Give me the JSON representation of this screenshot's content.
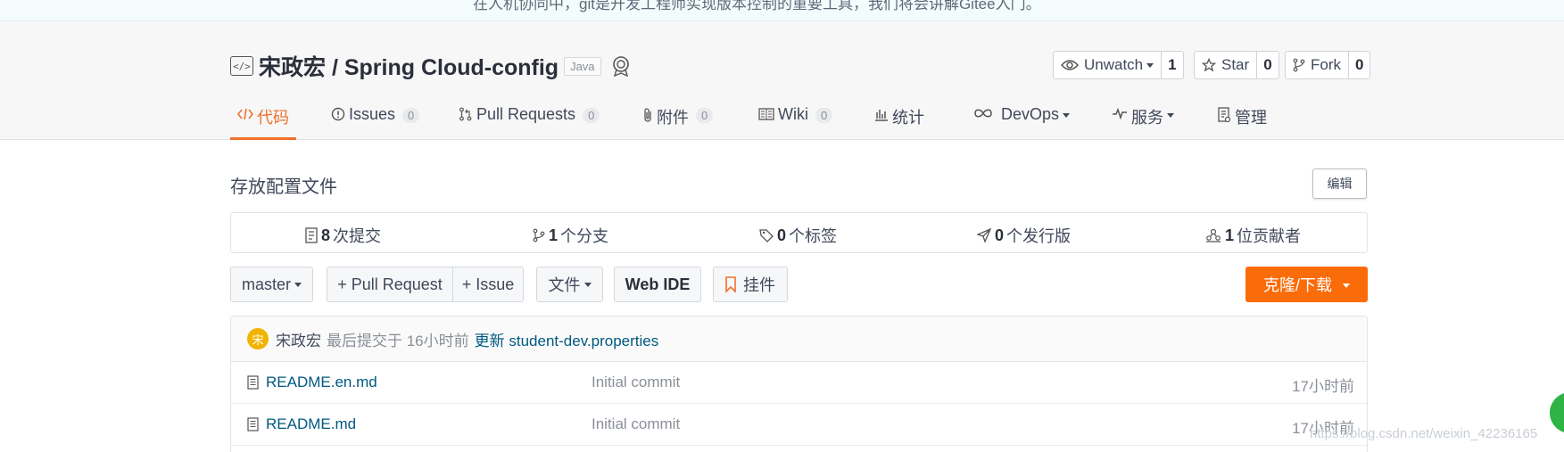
{
  "banner": {
    "text": "在人机协同中，git是开发工程师实现版本控制的重要工具，我们将会讲解Gitee入门。"
  },
  "repo": {
    "owner_and_name": "宋政宏 / Spring Cloud-config",
    "language": "Java",
    "description": "存放配置文件",
    "edit_label": "编辑"
  },
  "actions": {
    "watch_label": "Unwatch",
    "watch_count": "1",
    "star_label": "Star",
    "star_count": "0",
    "fork_label": "Fork",
    "fork_count": "0"
  },
  "tabs": [
    {
      "label": "代码",
      "icon": "code-icon"
    },
    {
      "label": "Issues",
      "count": "0",
      "icon": "issue-icon"
    },
    {
      "label": "Pull Requests",
      "count": "0",
      "icon": "pull-request-icon"
    },
    {
      "label": "附件",
      "count": "0",
      "icon": "paperclip-icon"
    },
    {
      "label": "Wiki",
      "count": "0",
      "icon": "wiki-icon"
    },
    {
      "label": "统计",
      "icon": "chart-icon"
    },
    {
      "label": "DevOps",
      "icon": "infinity-icon"
    },
    {
      "label": "服务",
      "icon": "pulse-icon"
    },
    {
      "label": "管理",
      "icon": "settings-doc-icon"
    }
  ],
  "stats": [
    {
      "count": "8",
      "label": "次提交",
      "icon": "commit-icon"
    },
    {
      "count": "1",
      "label": "个分支",
      "icon": "branch-icon"
    },
    {
      "count": "0",
      "label": "个标签",
      "icon": "tag-icon"
    },
    {
      "count": "0",
      "label": "个发行版",
      "icon": "release-icon"
    },
    {
      "count": "1",
      "label": "位贡献者",
      "icon": "contributors-icon"
    }
  ],
  "toolbar": {
    "branch": "master",
    "pull_request": "+ Pull Request",
    "issue": "+ Issue",
    "file": "文件",
    "web_ide": "Web IDE",
    "widget": "挂件",
    "clone": "克隆/下载"
  },
  "last_commit": {
    "avatar_char": "宋",
    "author": "宋政宏",
    "time": "最后提交于 16小时前",
    "message": "更新 student-dev.properties"
  },
  "files": [
    {
      "name": "README.en.md",
      "message": "Initial commit",
      "time": "17小时前"
    },
    {
      "name": "README.md",
      "message": "Initial commit",
      "time": "17小时前"
    }
  ],
  "watermark": "https://blog.csdn.net/weixin_42236165",
  "colors": {
    "accent": "#f0702c",
    "clone_button": "#fa6c0a",
    "link": "#005980",
    "avatar": "#f0b400"
  }
}
